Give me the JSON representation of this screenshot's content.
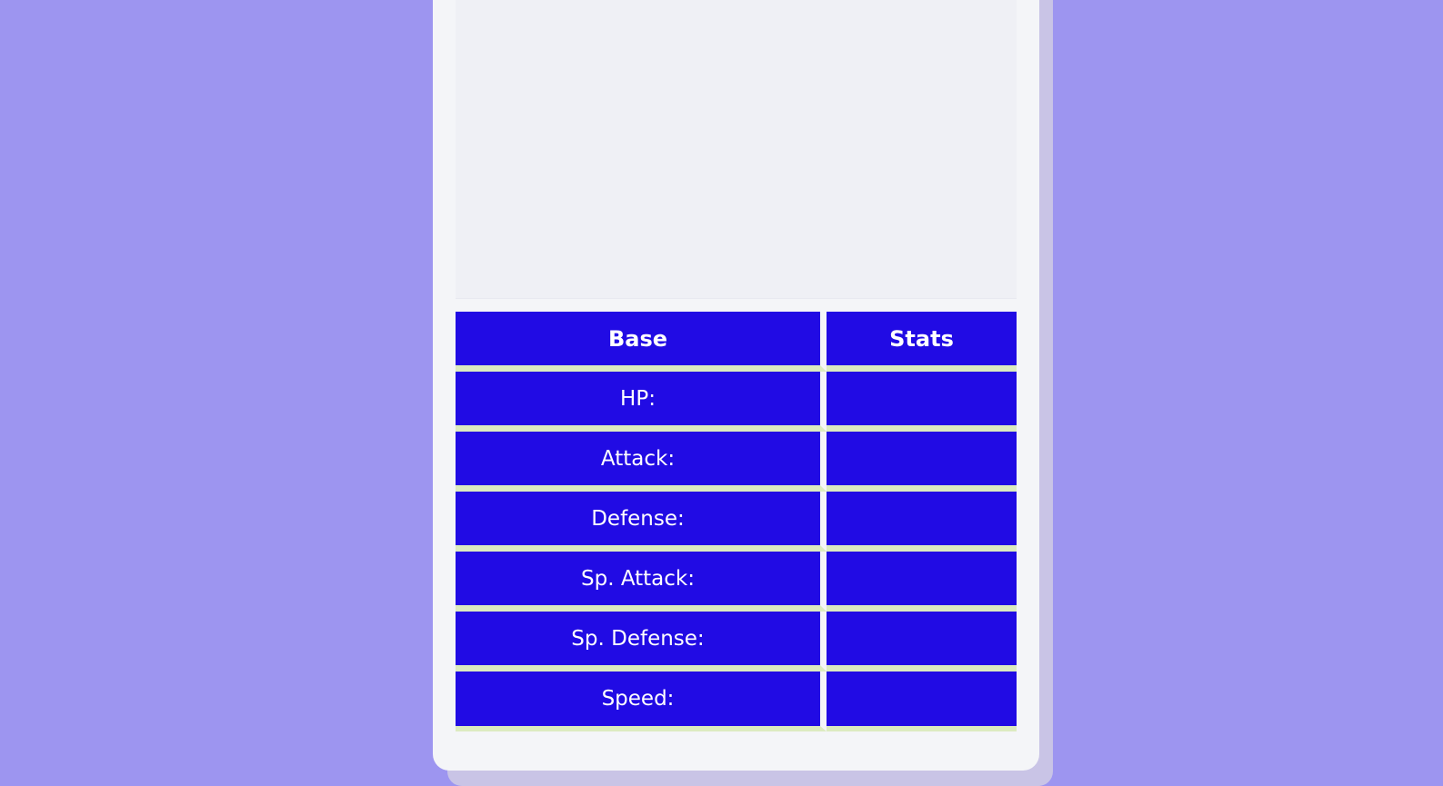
{
  "colors": {
    "background": "#9d95f0",
    "card": "#f4f5f8",
    "table_cell": "#210be4",
    "row_divider": "#dcebc0"
  },
  "table": {
    "headers": [
      "Base",
      "Stats"
    ],
    "rows": [
      {
        "label": "HP:",
        "value": ""
      },
      {
        "label": "Attack:",
        "value": ""
      },
      {
        "label": "Defense:",
        "value": ""
      },
      {
        "label": "Sp. Attack:",
        "value": ""
      },
      {
        "label": "Sp. Defense:",
        "value": ""
      },
      {
        "label": "Speed:",
        "value": ""
      }
    ]
  }
}
